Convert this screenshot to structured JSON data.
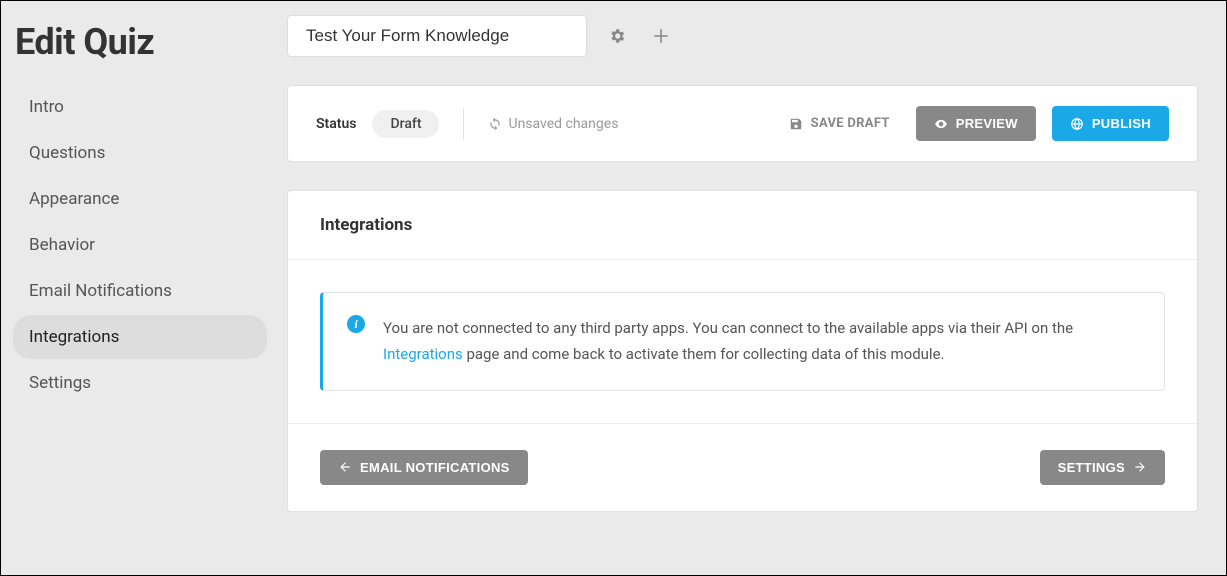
{
  "page": {
    "title": "Edit Quiz"
  },
  "sidebar": {
    "items": [
      {
        "label": "Intro",
        "active": false
      },
      {
        "label": "Questions",
        "active": false
      },
      {
        "label": "Appearance",
        "active": false
      },
      {
        "label": "Behavior",
        "active": false
      },
      {
        "label": "Email Notifications",
        "active": false
      },
      {
        "label": "Integrations",
        "active": true
      },
      {
        "label": "Settings",
        "active": false
      }
    ]
  },
  "header": {
    "quiz_title": "Test Your Form Knowledge"
  },
  "status_bar": {
    "status_label": "Status",
    "status_value": "Draft",
    "unsaved_label": "Unsaved changes",
    "save_draft_label": "SAVE DRAFT",
    "preview_label": "PREVIEW",
    "publish_label": "PUBLISH"
  },
  "panel": {
    "title": "Integrations",
    "notice_before": "You are not connected to any third party apps. You can connect to the available apps via their API on the ",
    "notice_link": "Integrations",
    "notice_after": " page and come back to activate them for collecting data of this module.",
    "prev_label": "EMAIL NOTIFICATIONS",
    "next_label": "SETTINGS"
  }
}
